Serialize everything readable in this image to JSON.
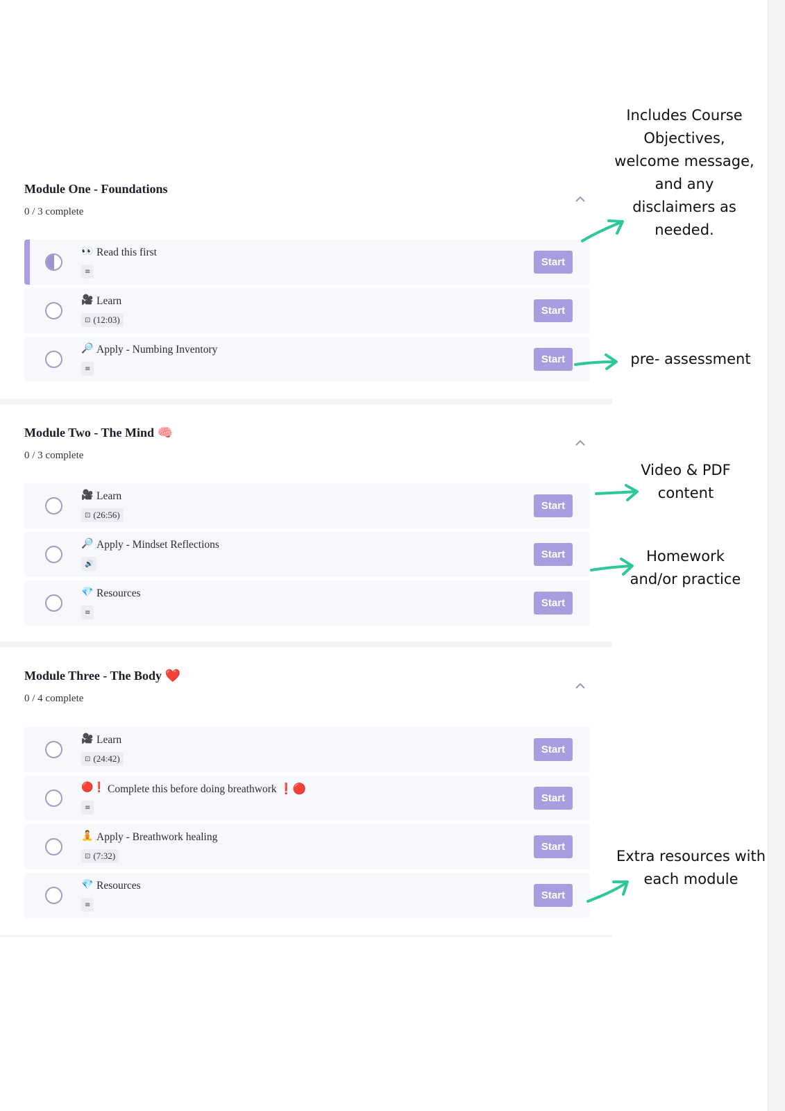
{
  "colors": {
    "accent": "#a99de0",
    "annotation_arrow": "#2ec79a"
  },
  "modules": [
    {
      "title": "Module One - Foundations",
      "progress": "0 / 3 complete",
      "lessons": [
        {
          "emoji": "👀",
          "title": "Read this first",
          "meta_icon": "text-lines-icon",
          "meta_glyph": "≡",
          "duration": "",
          "status": "in-progress",
          "button": "Start"
        },
        {
          "emoji": "🎥",
          "title": "Learn",
          "meta_icon": "video-icon",
          "meta_glyph": "⊡",
          "duration": "(12:03)",
          "status": "not-started",
          "button": "Start"
        },
        {
          "emoji": "🔎",
          "title": "Apply - Numbing Inventory",
          "meta_icon": "text-lines-icon",
          "meta_glyph": "≡",
          "duration": "",
          "status": "not-started",
          "button": "Start"
        }
      ]
    },
    {
      "title": "Module Two - The Mind 🧠",
      "progress": "0 / 3 complete",
      "lessons": [
        {
          "emoji": "🎥",
          "title": "Learn",
          "meta_icon": "video-icon",
          "meta_glyph": "⊡",
          "duration": "(26:56)",
          "status": "not-started",
          "button": "Start"
        },
        {
          "emoji": "🔎",
          "title": "Apply - Mindset Reflections",
          "meta_icon": "audio-icon",
          "meta_glyph": "🔊",
          "duration": "",
          "status": "not-started",
          "button": "Start"
        },
        {
          "emoji": "💎",
          "title": "Resources",
          "meta_icon": "text-lines-icon",
          "meta_glyph": "≡",
          "duration": "",
          "status": "not-started",
          "button": "Start"
        }
      ]
    },
    {
      "title": "Module Three - The Body ❤️",
      "progress": "0 / 4 complete",
      "lessons": [
        {
          "emoji": "🎥",
          "title": "Learn",
          "meta_icon": "video-icon",
          "meta_glyph": "⊡",
          "duration": "(24:42)",
          "status": "not-started",
          "button": "Start"
        },
        {
          "emoji": "🔴❗",
          "title": "  Complete this before doing breathwork ❗🔴",
          "meta_icon": "text-lines-icon",
          "meta_glyph": "≡",
          "duration": "",
          "status": "not-started",
          "button": "Start"
        },
        {
          "emoji": "🧘",
          "title": "Apply - Breathwork healing",
          "meta_icon": "video-icon",
          "meta_glyph": "⊡",
          "duration": "(7:32)",
          "status": "not-started",
          "button": "Start"
        },
        {
          "emoji": "💎",
          "title": "Resources",
          "meta_icon": "text-lines-icon",
          "meta_glyph": "≡",
          "duration": "",
          "status": "not-started",
          "button": "Start"
        }
      ]
    }
  ],
  "annotations": [
    {
      "text": "Includes Course\nObjectives,\nwelcome message,\nand any\ndisclaimers as\nneeded."
    },
    {
      "text": "pre- assessment"
    },
    {
      "text": "Video & PDF\ncontent"
    },
    {
      "text": "Homework\nand/or practice"
    },
    {
      "text": "Extra resources with\neach module"
    }
  ]
}
